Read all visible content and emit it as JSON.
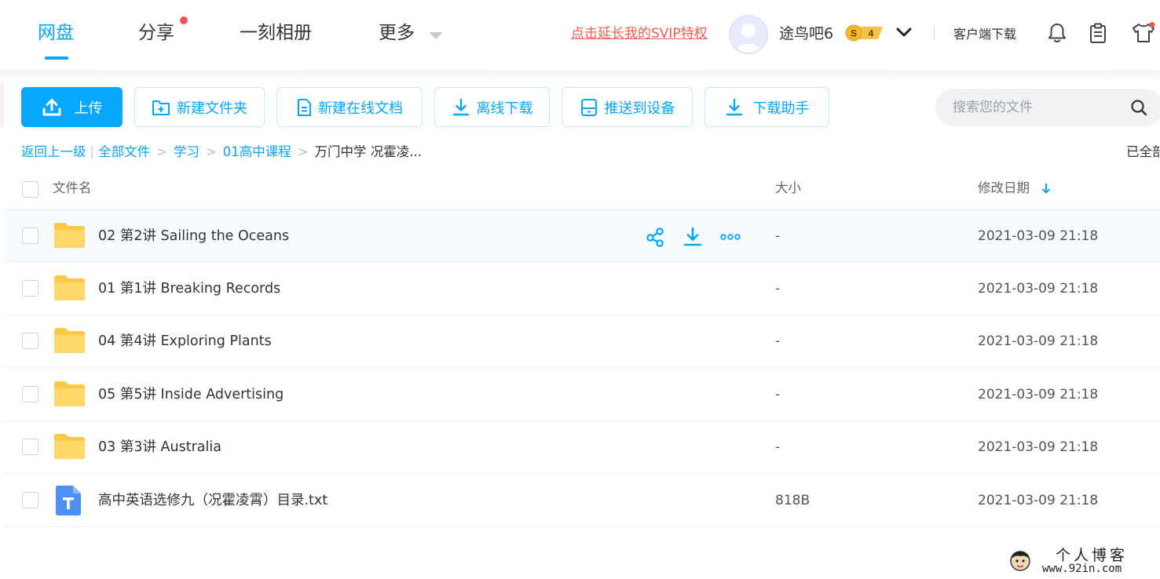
{
  "nav": {
    "items": [
      {
        "label": "网盘",
        "active": true
      },
      {
        "label": "分享",
        "dot": true
      },
      {
        "label": "一刻相册"
      },
      {
        "label": "更多"
      }
    ],
    "svip_link": "点击延长我的SVIP特权",
    "username": "途鸟吧6",
    "vip_level": "4",
    "client_download": "客户端下载",
    "icons": [
      "bell-icon",
      "clipboard-icon",
      "tshirt-icon"
    ],
    "accent_color": "#06a7ff",
    "alert_color": "#f5544d"
  },
  "toolbar": {
    "upload": "上传",
    "new_folder": "新建文件夹",
    "new_doc": "新建在线文档",
    "offline_download": "离线下载",
    "push_device": "推送到设备",
    "download_helper": "下载助手"
  },
  "search": {
    "placeholder": "搜索您的文件"
  },
  "breadcrumb": {
    "back": "返回上一级",
    "items": [
      "全部文件",
      "学习",
      "01高中课程"
    ],
    "current": "万门中学 况霍凌..."
  },
  "select_all_hint": "已全部",
  "table": {
    "headers": {
      "name": "文件名",
      "size": "大小",
      "modified": "修改日期"
    },
    "rows": [
      {
        "type": "folder",
        "name": "02 第2讲 Sailing the Oceans",
        "size": "-",
        "modified": "2021-03-09 21:18"
      },
      {
        "type": "folder",
        "name": "01 第1讲 Breaking Records",
        "size": "-",
        "modified": "2021-03-09 21:18"
      },
      {
        "type": "folder",
        "name": "04 第4讲 Exploring Plants",
        "size": "-",
        "modified": "2021-03-09 21:18"
      },
      {
        "type": "folder",
        "name": "05 第5讲 Inside Advertising",
        "size": "-",
        "modified": "2021-03-09 21:18"
      },
      {
        "type": "folder",
        "name": "03 第3讲 Australia",
        "size": "-",
        "modified": "2021-03-09 21:18"
      },
      {
        "type": "txt",
        "name": "高中英语选修九（况霍凌霄）目录.txt",
        "size": "818B",
        "modified": "2021-03-09 21:18"
      }
    ]
  },
  "watermark": {
    "title": "个人博客",
    "url": "www.92in.com"
  }
}
